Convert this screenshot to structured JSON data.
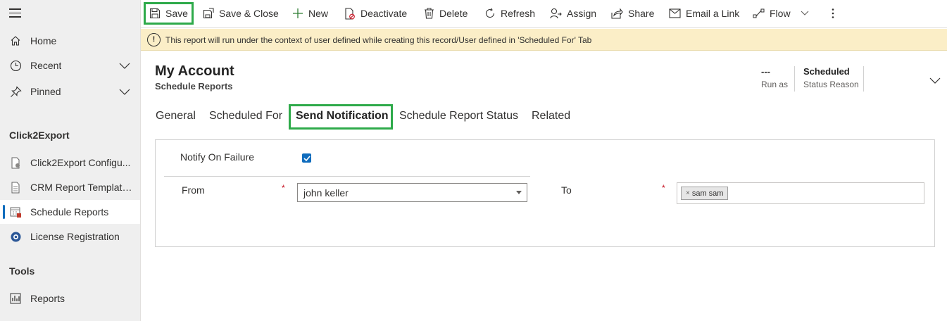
{
  "sidebar": {
    "items": [
      {
        "label": "Home",
        "icon": "home-icon"
      },
      {
        "label": "Recent",
        "icon": "clock-icon"
      },
      {
        "label": "Pinned",
        "icon": "pin-icon"
      }
    ],
    "group1_title": "Click2Export",
    "group1_items": [
      {
        "label": "Click2Export Configu..."
      },
      {
        "label": "CRM Report Templates"
      },
      {
        "label": "Schedule Reports"
      },
      {
        "label": "License Registration"
      }
    ],
    "group2_title": "Tools",
    "group2_items": [
      {
        "label": "Reports"
      }
    ]
  },
  "toolbar": {
    "save": "Save",
    "save_close": "Save & Close",
    "new": "New",
    "deactivate": "Deactivate",
    "delete": "Delete",
    "refresh": "Refresh",
    "assign": "Assign",
    "share": "Share",
    "email_link": "Email a Link",
    "flow": "Flow"
  },
  "banner": {
    "message": "This report will run under the context of user defined while creating this record/User defined in 'Scheduled For' Tab"
  },
  "header": {
    "title": "My Account",
    "entity": "Schedule Reports",
    "fields": [
      {
        "value": "---",
        "label": "Run as"
      },
      {
        "value": "Scheduled",
        "label": "Status Reason"
      }
    ]
  },
  "tabs": [
    "General",
    "Scheduled For",
    "Send Notification",
    "Schedule Report Status",
    "Related"
  ],
  "form": {
    "notify_label": "Notify On Failure",
    "notify_checked": true,
    "from_label": "From",
    "from_value": "john keller",
    "to_label": "To",
    "to_chip": "sam sam",
    "required_mark": "*"
  },
  "colors": {
    "highlight_box": "#2eaa4a",
    "accent": "#0f6cbd",
    "banner_bg": "#fbeec7"
  }
}
